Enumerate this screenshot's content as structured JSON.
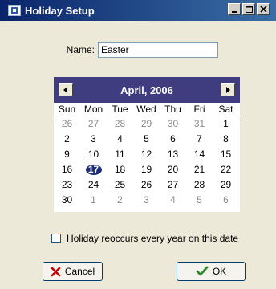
{
  "window": {
    "title": "Holiday Setup",
    "controls": {
      "minimize": "_",
      "maximize": "□",
      "close": "×"
    }
  },
  "form": {
    "name_label": "Name:",
    "name_value": "Easter"
  },
  "calendar": {
    "month_label": "April, 2006",
    "weekdays": [
      "Sun",
      "Mon",
      "Tue",
      "Wed",
      "Thu",
      "Fri",
      "Sat"
    ],
    "days": [
      {
        "d": "26",
        "out": true
      },
      {
        "d": "27",
        "out": true
      },
      {
        "d": "28",
        "out": true
      },
      {
        "d": "29",
        "out": true
      },
      {
        "d": "30",
        "out": true
      },
      {
        "d": "31",
        "out": true
      },
      {
        "d": "1",
        "out": false
      },
      {
        "d": "2",
        "out": false
      },
      {
        "d": "3",
        "out": false
      },
      {
        "d": "4",
        "out": false
      },
      {
        "d": "5",
        "out": false
      },
      {
        "d": "6",
        "out": false
      },
      {
        "d": "7",
        "out": false
      },
      {
        "d": "8",
        "out": false
      },
      {
        "d": "9",
        "out": false
      },
      {
        "d": "10",
        "out": false
      },
      {
        "d": "11",
        "out": false
      },
      {
        "d": "12",
        "out": false
      },
      {
        "d": "13",
        "out": false
      },
      {
        "d": "14",
        "out": false
      },
      {
        "d": "15",
        "out": false
      },
      {
        "d": "16",
        "out": false
      },
      {
        "d": "17",
        "out": false,
        "selected": true
      },
      {
        "d": "18",
        "out": false
      },
      {
        "d": "19",
        "out": false
      },
      {
        "d": "20",
        "out": false
      },
      {
        "d": "21",
        "out": false
      },
      {
        "d": "22",
        "out": false
      },
      {
        "d": "23",
        "out": false
      },
      {
        "d": "24",
        "out": false
      },
      {
        "d": "25",
        "out": false
      },
      {
        "d": "26",
        "out": false
      },
      {
        "d": "27",
        "out": false
      },
      {
        "d": "28",
        "out": false
      },
      {
        "d": "29",
        "out": false
      },
      {
        "d": "30",
        "out": false
      },
      {
        "d": "1",
        "out": true
      },
      {
        "d": "2",
        "out": true
      },
      {
        "d": "3",
        "out": true
      },
      {
        "d": "4",
        "out": true
      },
      {
        "d": "5",
        "out": true
      },
      {
        "d": "6",
        "out": true
      }
    ],
    "header_color": "#3f3c80"
  },
  "options": {
    "recur_label": "Holiday reoccurs every year on this date",
    "recur_checked": false
  },
  "buttons": {
    "cancel_label": "Cancel",
    "cancel_icon": "x-icon",
    "ok_label": "OK",
    "ok_icon": "checkmark-icon"
  }
}
